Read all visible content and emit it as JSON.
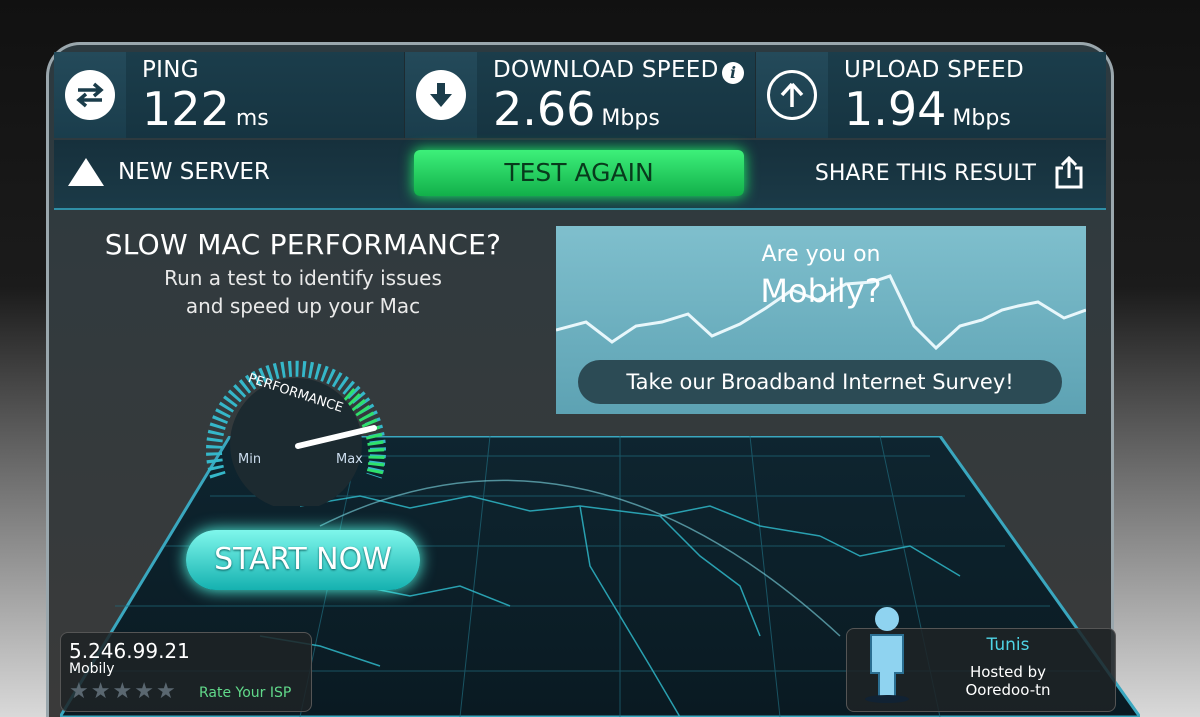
{
  "stats": {
    "ping": {
      "label": "PING",
      "value": "122",
      "unit": "ms",
      "icon": "ping-arrows-icon"
    },
    "download": {
      "label": "DOWNLOAD SPEED",
      "value": "2.66",
      "unit": "Mbps",
      "icon": "download-arrow-icon",
      "info": "i"
    },
    "upload": {
      "label": "UPLOAD SPEED",
      "value": "1.94",
      "unit": "Mbps",
      "icon": "upload-arrow-icon"
    }
  },
  "actions": {
    "new_server": "NEW SERVER",
    "test_again": "TEST AGAIN",
    "share": "SHARE THIS RESULT"
  },
  "ad_left": {
    "title": "SLOW MAC PERFORMANCE?",
    "line1": "Run a test to identify issues",
    "line2": "and speed up your Mac",
    "gauge_title": "PERFORMANCE",
    "gauge_min": "Min",
    "gauge_max": "Max",
    "cta": "START NOW"
  },
  "ad_right": {
    "q1": "Are you on",
    "q2": "Mobily?",
    "cta": "Take our Broadband Internet Survey!"
  },
  "client": {
    "ip": "5.246.99.21",
    "isp": "Mobily",
    "rating_stars": 5,
    "rate_label": "Rate Your ISP"
  },
  "server": {
    "city": "Tunis",
    "hosted_by_label": "Hosted by",
    "host": "Ooredoo-tn"
  },
  "colors": {
    "accent_green": "#1fd65b",
    "accent_teal": "#39d6cf",
    "panel_blue": "#1b3d4b"
  }
}
